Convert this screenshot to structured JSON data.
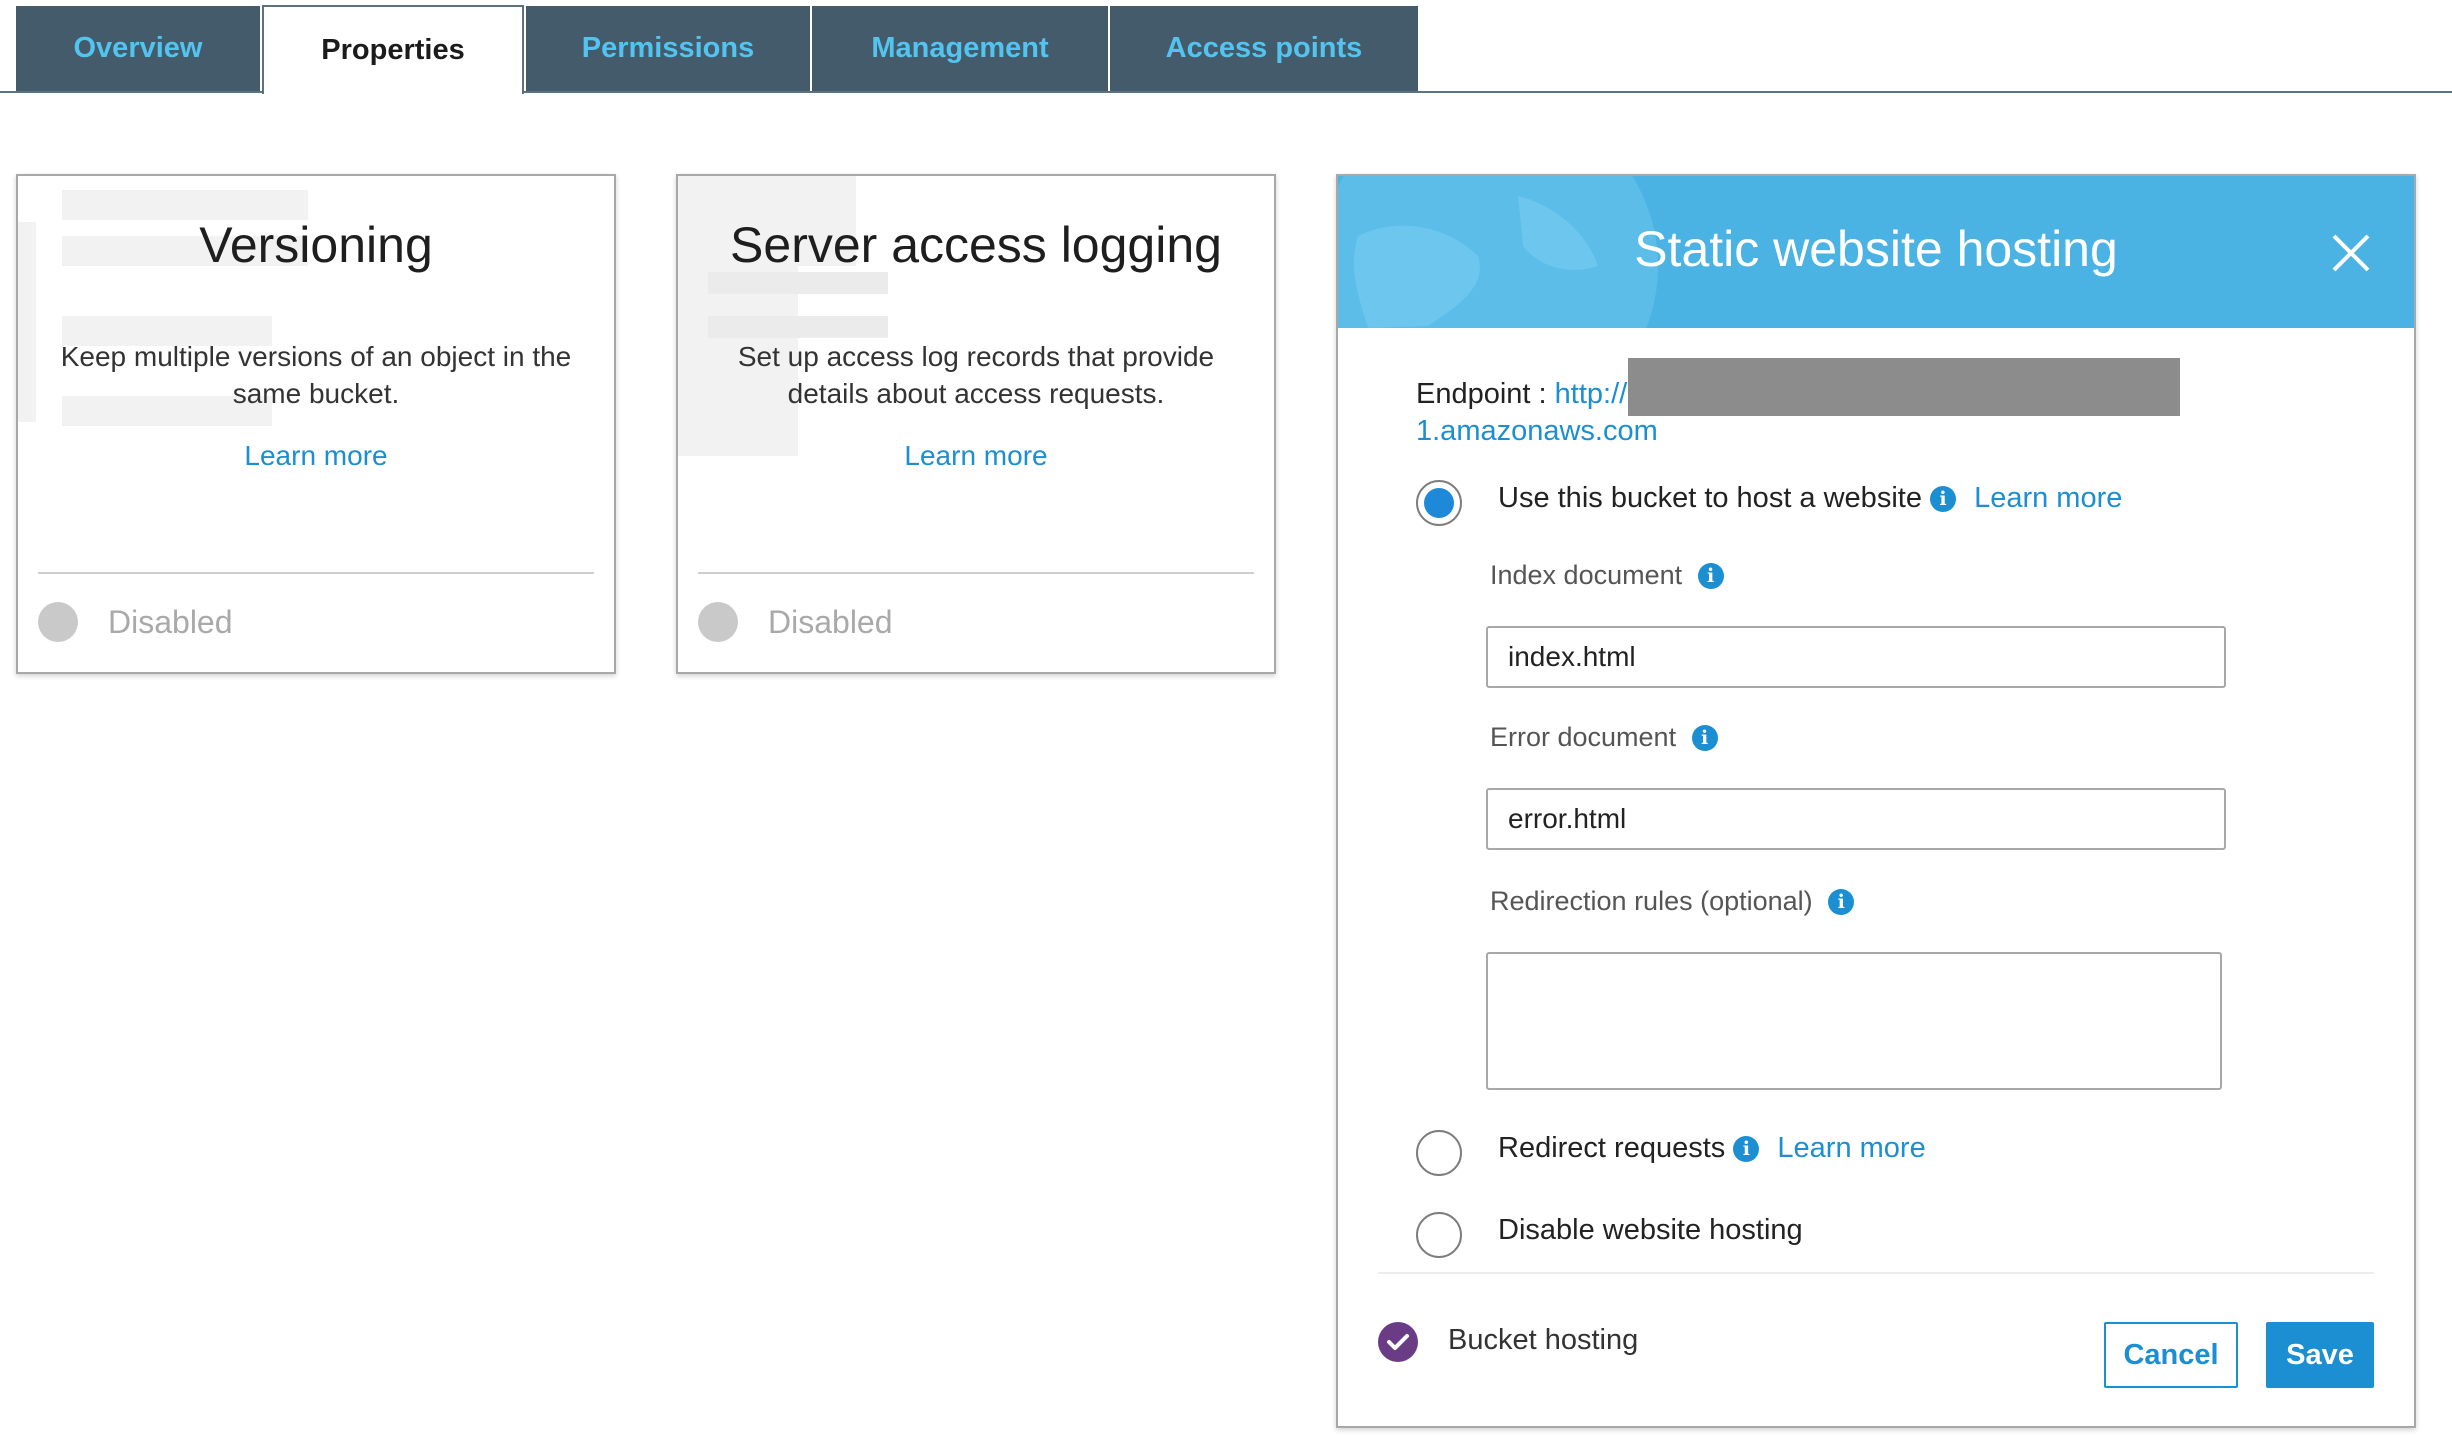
{
  "tabs": [
    {
      "label": "Overview"
    },
    {
      "label": "Properties"
    },
    {
      "label": "Permissions"
    },
    {
      "label": "Management"
    },
    {
      "label": "Access points"
    }
  ],
  "active_tab": "Properties",
  "cards": {
    "versioning": {
      "title": "Versioning",
      "description": "Keep multiple versions of an object in the same bucket.",
      "link": "Learn more",
      "status": "Disabled"
    },
    "logging": {
      "title": "Server access logging",
      "description": "Set up access log records that provide details about access requests.",
      "link": "Learn more",
      "status": "Disabled"
    }
  },
  "panel": {
    "title": "Static website hosting",
    "endpoint_label": "Endpoint :",
    "endpoint_prefix": "http://",
    "endpoint_suffix": "1.amazonaws.com",
    "option_host": "Use this bucket to host a website",
    "option_host_link": "Learn more",
    "index_label": "Index document",
    "index_value": "index.html",
    "error_label": "Error document",
    "error_value": "error.html",
    "redirection_label": "Redirection rules (optional)",
    "option_redirect": "Redirect requests",
    "option_redirect_link": "Learn more",
    "option_disable": "Disable website hosting",
    "footer_label": "Bucket hosting",
    "cancel": "Cancel",
    "save": "Save"
  },
  "colors": {
    "tab_bg": "#445b6b",
    "tab_text": "#53c4f0",
    "header_blue": "#4ab3e4",
    "link_blue": "#1b8fd1",
    "check_purple": "#6b3c86"
  },
  "icons": [
    "close-icon",
    "info-icon",
    "check-icon"
  ]
}
